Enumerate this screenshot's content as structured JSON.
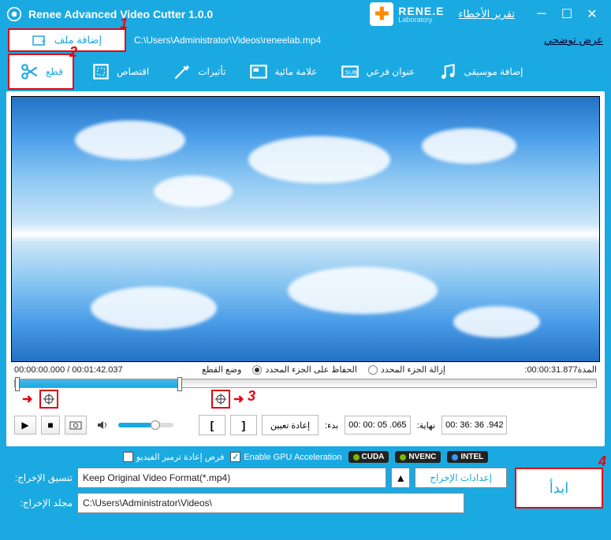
{
  "titlebar": {
    "app_title": "Renee Advanced Video Cutter 1.0.0",
    "logo_main": "RENE.E",
    "logo_sub": "Laboratory",
    "report_link": "تقرير الأخطاء"
  },
  "topbar": {
    "add_file": "إضافة ملف",
    "file_path": "C:\\Users\\Administrator\\Videos\\reneelab.mp4",
    "demo_link": "عرض توضحي"
  },
  "toolbar": {
    "cut": "قطع",
    "crop": "اقتصاص",
    "effects": "تأثيرات",
    "watermark": "علامة مائية",
    "subtitle": "عنوان فرعي",
    "music": "إضافة موسيقى"
  },
  "timeline": {
    "position": "00:00:00.000 / 00:01:42.037",
    "mode_label": "وضع القطع",
    "keep_selected": "الحفاظ على الجزء المحدد",
    "remove_selected": "إزالة الجزء المحدد",
    "duration_label": ":المدة",
    "duration_value": "00:00:31.877"
  },
  "controls": {
    "reset": "إعادة تعيين",
    "start_label": ":بدء",
    "start_time": "00: 00: 05 .065",
    "end_label": ":نهاية",
    "end_time": "00: 36: 36 .942"
  },
  "options": {
    "force_recode": "فرض إعادة ترميز الفيديو",
    "gpu_accel": "Enable GPU Acceleration",
    "cuda": "CUDA",
    "nvenc": "NVENC",
    "intel": "INTEL"
  },
  "output": {
    "format_label": ":تنسيق الإخراج",
    "format_value": "Keep Original Video Format(*.mp4)",
    "settings_btn": "إعدادات الإخراج",
    "folder_label": ":مجلد الإخراج",
    "folder_value": "C:\\Users\\Administrator\\Videos\\",
    "start_btn": "ابدأ"
  },
  "annotations": {
    "n1": "1",
    "n2": "2",
    "n3": "3",
    "n4": "4"
  }
}
